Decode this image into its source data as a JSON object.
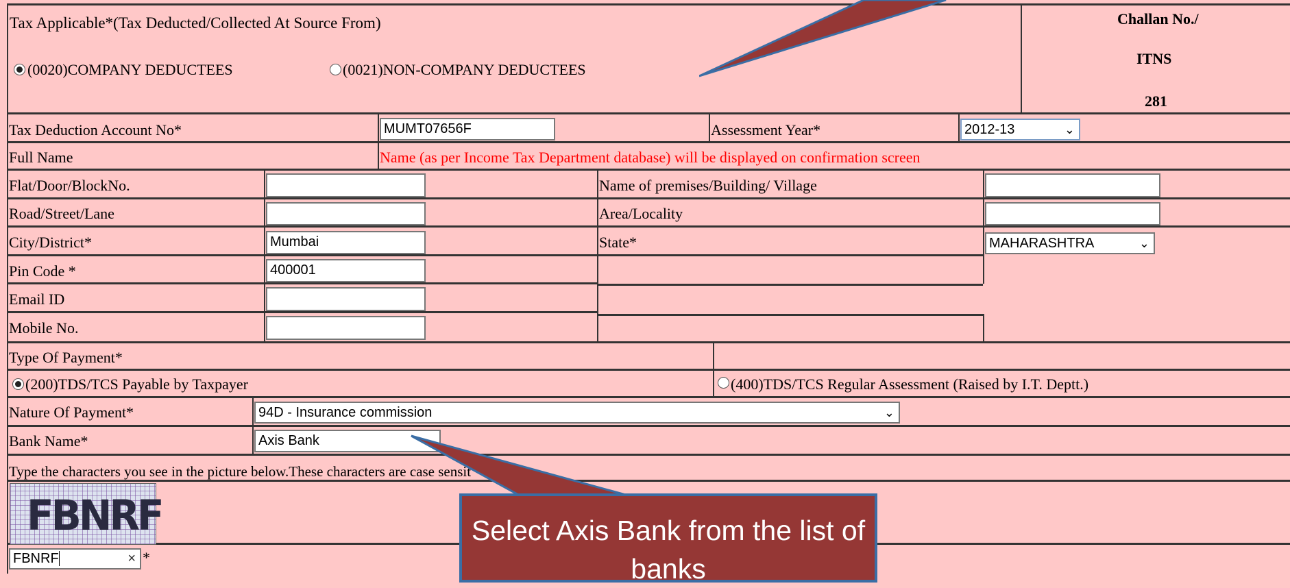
{
  "header": {
    "tax_applicable_label": "Tax Applicable*(Tax Deducted/Collected At Source From)",
    "option_company": "(0020)COMPANY DEDUCTEES",
    "option_noncompany": "(0021)NON-COMPANY DEDUCTEES",
    "selected_option": "(0020)COMPANY DEDUCTEES"
  },
  "challan": {
    "line1": "Challan No./",
    "line2": "ITNS",
    "line3": "281"
  },
  "form": {
    "tan_label": "Tax Deduction Account No*",
    "tan_value": "MUMT07656F",
    "ay_label": "Assessment Year*",
    "ay_value": "2012-13",
    "fullname_label": "Full Name",
    "fullname_note": "Name (as per Income Tax Department database) will be displayed on confirmation screen",
    "flat_label": "Flat/Door/BlockNo.",
    "flat_value": "",
    "premises_label": "Name of premises/Building/ Village",
    "premises_value": "",
    "road_label": "Road/Street/Lane",
    "road_value": "",
    "area_label": "Area/Locality",
    "area_value": "",
    "city_label": "City/District*",
    "city_value": "Mumbai",
    "state_label": "State*",
    "state_value": "MAHARASHTRA",
    "pin_label": "Pin Code *",
    "pin_value": "400001",
    "email_label": "Email ID",
    "email_value": "",
    "mobile_label": "Mobile No.",
    "mobile_value": "",
    "type_payment_label": "Type Of Payment*",
    "payment_200": "(200)TDS/TCS Payable by Taxpayer",
    "payment_400": "(400)TDS/TCS Regular Assessment (Raised by I.T. Deptt.)",
    "nature_label": "Nature Of Payment*",
    "nature_value": "94D - Insurance commission",
    "bank_label": "Bank Name*",
    "bank_value": "Axis Bank",
    "captcha_instruction": "Type the characters you see in the picture below.These characters are case sensit",
    "captcha_image_text": "FBNRF",
    "captcha_value": "FBNRF",
    "captcha_clear": "×",
    "required_mark": "*"
  },
  "callout": {
    "text": "Select Axis Bank from the list of banks"
  },
  "colors": {
    "background": "#ffc8c8",
    "callout_fill": "#953735",
    "callout_border": "#3a6ea5",
    "note_red": "#ff0000"
  }
}
